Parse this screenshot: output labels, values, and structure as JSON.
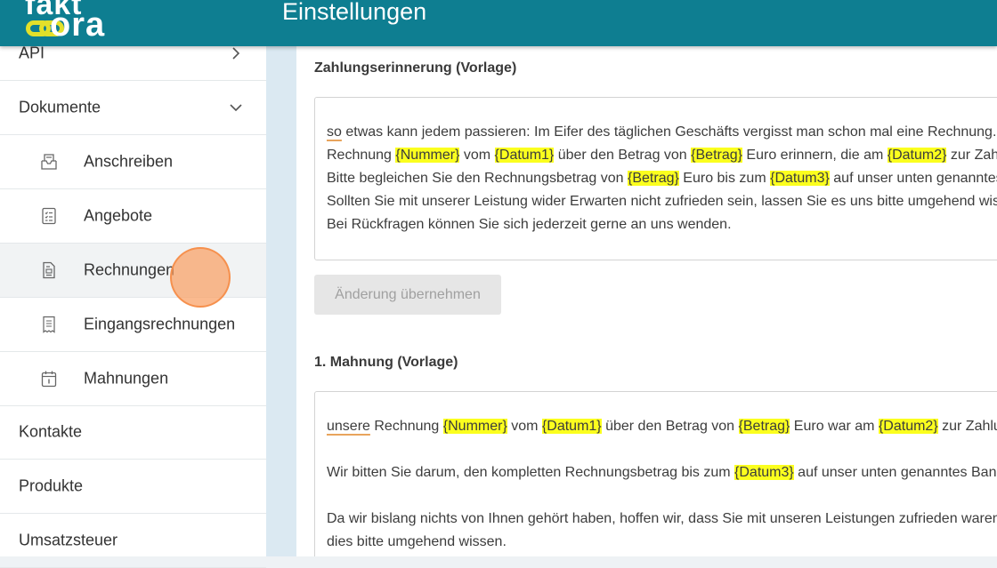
{
  "header": {
    "logo_top": "fakt",
    "logo_bottom": "ora",
    "title": "Einstellungen"
  },
  "sidebar": {
    "items": [
      {
        "label": "API",
        "level": "top",
        "chevron": "chevron-right-icon"
      },
      {
        "label": "Dokumente",
        "level": "top",
        "chevron": "chevron-down-icon"
      },
      {
        "label": "Anschreiben",
        "level": "sub",
        "icon": "letter-tray-icon"
      },
      {
        "label": "Angebote",
        "level": "sub",
        "icon": "checklist-icon"
      },
      {
        "label": "Rechnungen",
        "level": "sub",
        "icon": "invoice-icon",
        "active": true
      },
      {
        "label": "Eingangsrechnungen",
        "level": "sub",
        "icon": "receipt-icon"
      },
      {
        "label": "Mahnungen",
        "level": "sub",
        "icon": "calendar-icon"
      },
      {
        "label": "Kontakte",
        "level": "top"
      },
      {
        "label": "Produkte",
        "level": "top"
      },
      {
        "label": "Umsatzsteuer",
        "level": "top"
      }
    ]
  },
  "reminder": {
    "title": "Zahlungserinnerung (Vorlage)",
    "line1_a": "so",
    "line1_b": " etwas kann jedem passieren: Im Eifer des täglichen Geschäfts vergisst man schon mal eine Rechnung.",
    "line2_a": "Rechnung ",
    "line2_nummer": "{Nummer}",
    "line2_b": " vom ",
    "line2_datum1": "{Datum1}",
    "line2_c": " über den Betrag von ",
    "line2_betrag": "{Betrag}",
    "line2_d": " Euro erinnern, die am ",
    "line2_datum2": "{Datum2}",
    "line2_e": " zur Zahlung fällig war.",
    "line3_a": "Bitte begleichen Sie den Rechnungsbetrag von ",
    "line3_betrag": "{Betrag}",
    "line3_b": " Euro bis zum ",
    "line3_datum3": "{Datum3}",
    "line3_c": " auf unser unten genanntes Konto.",
    "line4": "Sollten Sie mit unserer Leistung wider Erwarten nicht zufrieden sein, lassen Sie es uns bitte umgehend wissen.",
    "line5": "Bei Rückfragen können Sie sich jederzeit gerne an uns wenden."
  },
  "apply_button": "Änderung übernehmen",
  "dunning": {
    "title": "1. Mahnung (Vorlage)",
    "line1_a": "unsere",
    "line1_b": " Rechnung ",
    "line1_nummer": "{Nummer}",
    "line1_c": " vom ",
    "line1_datum1": "{Datum1}",
    "line1_d": " über den Betrag von ",
    "line1_betrag": "{Betrag}",
    "line1_e": " Euro war am ",
    "line1_datum2": "{Datum2}",
    "line1_f": " zur Zahlung fällig.",
    "line2_a": "Wir bitten Sie darum, den kompletten Rechnungsbetrag bis zum ",
    "line2_datum3": "{Datum3}",
    "line2_b": " auf unser unten genanntes Bankkonto zu überweisen.",
    "line3": "Da wir bislang nichts von Ihnen gehört haben, hoffen wir, dass Sie mit unseren Leistungen zufrieden waren. Andernfalls lassen Sie uns",
    "line4": "dies bitte umgehend wissen."
  },
  "colors": {
    "header": "#0e7e91",
    "logo_accent": "#e3e02a",
    "placeholder_highlight": "#fbff1e",
    "click_indicator": "#faa064"
  }
}
